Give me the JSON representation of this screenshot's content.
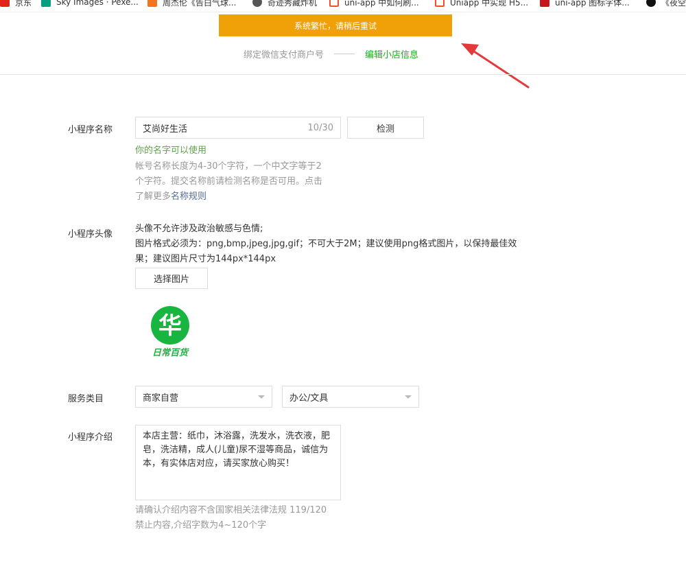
{
  "bookmarks": [
    {
      "label": "京东",
      "color": "#e1251b"
    },
    {
      "label": "Sky Images · Pexe...",
      "color": "#05a081"
    },
    {
      "label": "周杰伦《告白气球...",
      "color": "#f5751e"
    },
    {
      "label": "奇迹秀藏炸机",
      "color": "#555555"
    },
    {
      "label": "uni-app 中如何刷...",
      "color": "#f0522b"
    },
    {
      "label": "Uniapp 中实现 H5...",
      "color": "#f0522b"
    },
    {
      "label": "uni-app 图标字体...",
      "color": "#c8161d"
    },
    {
      "label": "《夜空",
      "color": "#111111"
    }
  ],
  "toast": "系统繁忙，请稍后重试",
  "steps": {
    "step1": "绑定微信支付商户号",
    "step2": "编辑小店信息"
  },
  "form": {
    "name_label": "小程序名称",
    "name_value": "艾尚好生活",
    "name_count": "10/30",
    "check_button": "检测",
    "name_ok": "你的名字可以使用",
    "name_tip_1": "帐号名称长度为4-30个字符，一个中文字等于2",
    "name_tip_2": "个字符。提交名称前请检测名称是否可用。点击",
    "name_tip_3": "了解更多",
    "name_tip_link": "名称规则",
    "avatar_label": "小程序头像",
    "avatar_desc_1": "头像不允许涉及政治敏感与色情;",
    "avatar_desc_2": "图片格式必须为：png,bmp,jpeg,jpg,gif；不可大于2M；建议使用png格式图片，以保持最佳效",
    "avatar_desc_3": "果；建议图片尺寸为144px*144px",
    "choose_image_button": "选择图片",
    "logo_char": "华",
    "logo_text": "日常百货",
    "category_label": "服务类目",
    "category_1": "商家自营",
    "category_2": "办公/文具",
    "intro_label": "小程序介绍",
    "intro_value": "本店主营：纸巾，沐浴露，洗发水，洗衣液，肥皂，洗洁精，成人(儿童)尿不湿等商品，诚信为本，有实体店对应，请买家放心购买！",
    "intro_tip_1": "请确认介绍内容不含国家相关法律法规 119/120",
    "intro_tip_2": "禁止内容,介绍字数为4~120个字"
  },
  "colors": {
    "toast_bg": "#f0a108",
    "accent_green": "#1aad19",
    "ok_green": "#61a34c",
    "link_blue": "#576b95",
    "logo_green": "#18b640",
    "arrow_red": "#e5383b"
  }
}
